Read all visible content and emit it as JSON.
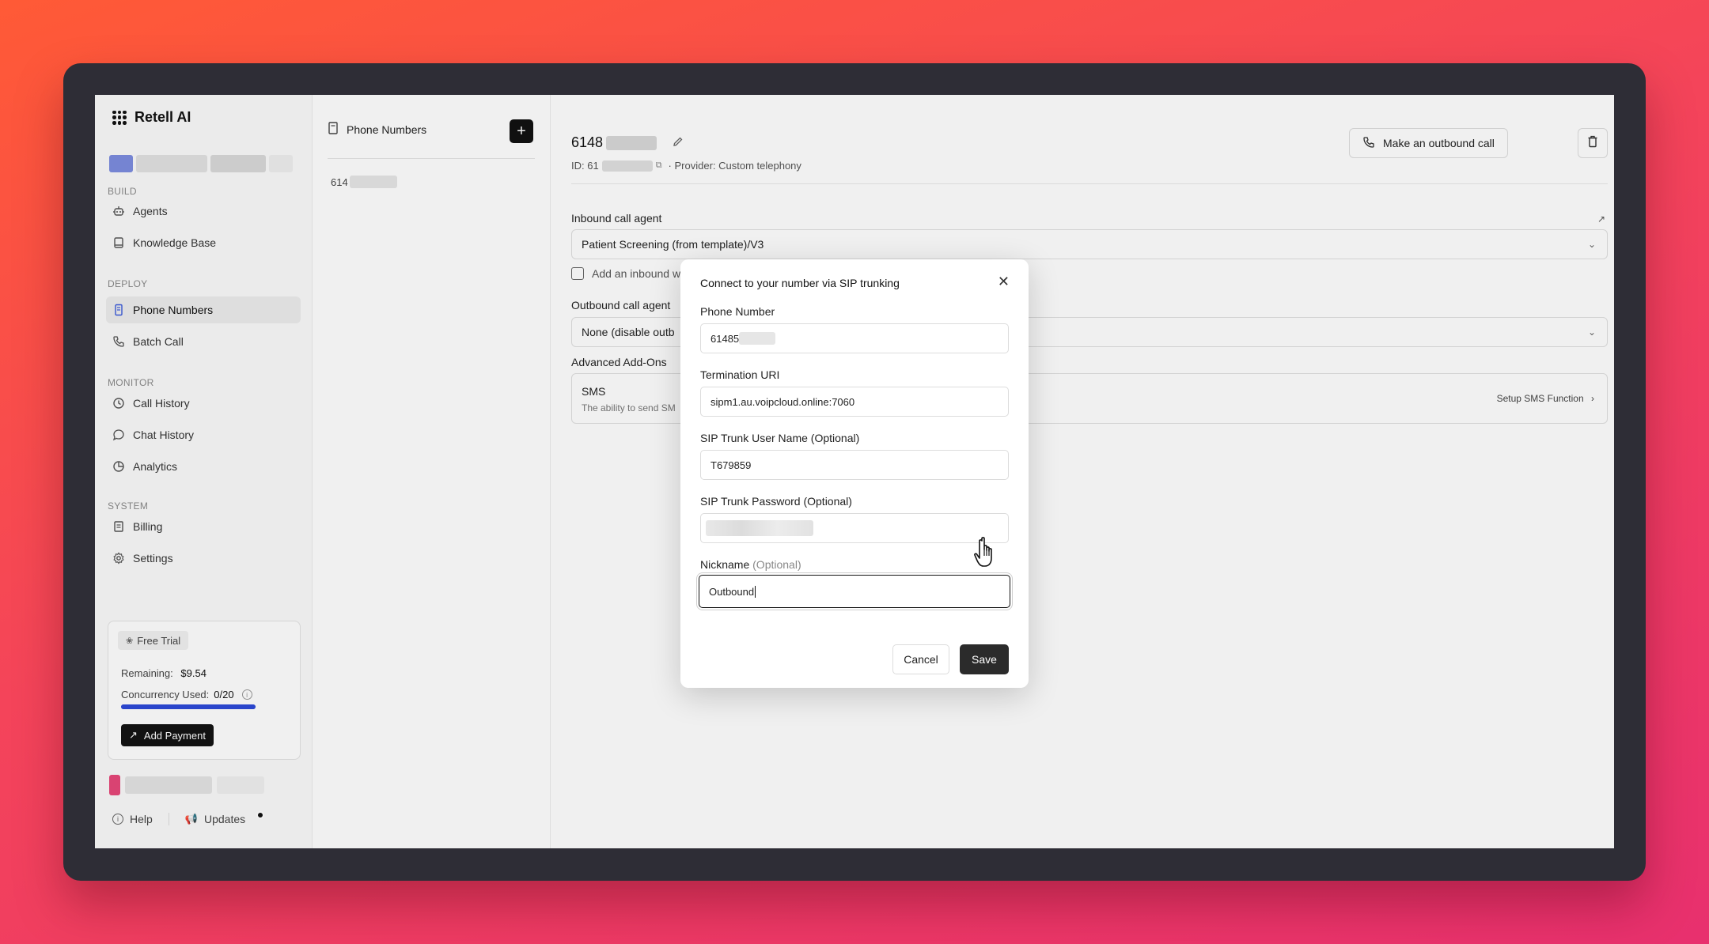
{
  "app": {
    "name": "Retell AI"
  },
  "sidebar": {
    "sections": [
      {
        "label": "BUILD"
      },
      {
        "label": "DEPLOY"
      },
      {
        "label": "MONITOR"
      },
      {
        "label": "SYSTEM"
      }
    ],
    "items": [
      {
        "label": "Agents",
        "icon": "robot-icon"
      },
      {
        "label": "Knowledge Base",
        "icon": "book-icon"
      },
      {
        "label": "Phone Numbers",
        "icon": "phone-list-icon",
        "active": true
      },
      {
        "label": "Batch Call",
        "icon": "phone-icon"
      },
      {
        "label": "Call History",
        "icon": "history-icon"
      },
      {
        "label": "Chat History",
        "icon": "chat-icon"
      },
      {
        "label": "Analytics",
        "icon": "pie-chart-icon"
      },
      {
        "label": "Billing",
        "icon": "receipt-icon"
      },
      {
        "label": "Settings",
        "icon": "gear-icon"
      }
    ],
    "trial": {
      "badge": "Free Trial",
      "remaining_label": "Remaining:",
      "remaining_value": "$9.54",
      "concurrency_label": "Concurrency Used:",
      "concurrency_value": "0/20",
      "concurrency_fraction": 0.0,
      "add_payment": "Add Payment"
    },
    "footer": {
      "help": "Help",
      "updates": "Updates"
    }
  },
  "list": {
    "title": "Phone Numbers",
    "items": [
      {
        "label": "614"
      }
    ]
  },
  "detail": {
    "number": "6148",
    "id_prefix": "ID: 61",
    "provider": "· Provider: Custom telephony",
    "outbound_button": "Make an outbound call",
    "inbound_label": "Inbound call agent",
    "inbound_value": "Patient Screening (from template)/V3",
    "inbound_checkbox": "Add an inbound w",
    "outbound_label": "Outbound call agent",
    "outbound_value": "None (disable outb",
    "addons_label": "Advanced Add-Ons",
    "sms_title": "SMS",
    "sms_desc": "The ability to send SM",
    "sms_setup": "Setup SMS Function"
  },
  "modal": {
    "title": "Connect to your number via SIP trunking",
    "fields": [
      {
        "label": "Phone Number",
        "value": "61485"
      },
      {
        "label": "Termination URI",
        "value": "sipm1.au.voipcloud.online:7060"
      },
      {
        "label": "SIP Trunk User Name (Optional)",
        "value": "T679859"
      },
      {
        "label": "SIP Trunk Password (Optional)",
        "value": ""
      },
      {
        "label": "Nickname",
        "label_optional": "(Optional)",
        "value": "Outbound"
      }
    ],
    "cancel": "Cancel",
    "save": "Save"
  },
  "colors": {
    "accent_blue": "#2d4ad8",
    "primary_dark": "#111111",
    "background_gradient_start": "#ff5a36",
    "background_gradient_end": "#e8306e"
  }
}
